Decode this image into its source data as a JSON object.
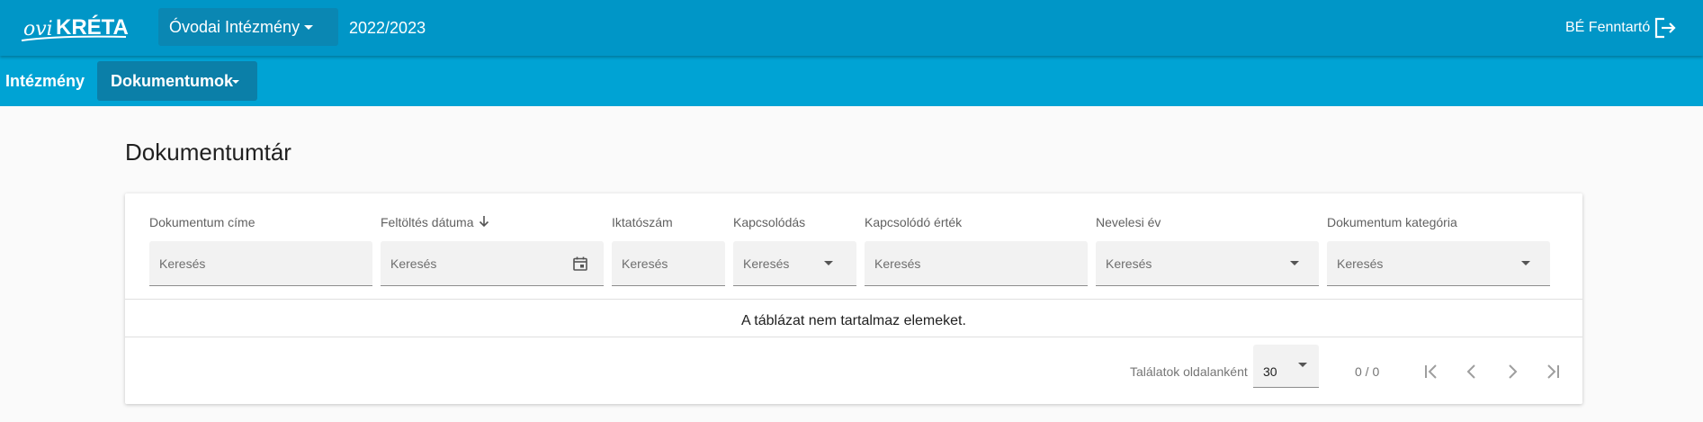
{
  "header": {
    "logo_text": "oviKRÉTA",
    "institution": "Óvodai Intézmény",
    "school_year": "2022/2023",
    "user": "BÉ Fenntartó",
    "color": "#0096c7"
  },
  "nav": {
    "items": [
      {
        "label": "Intézmény"
      },
      {
        "label": "Dokumentumok",
        "active": true
      }
    ],
    "color": "#00a3d4"
  },
  "page": {
    "title": "Dokumentumtár"
  },
  "table": {
    "columns": [
      {
        "label": "Dokumentum címe",
        "placeholder": "Keresés",
        "type": "text"
      },
      {
        "label": "Feltöltés dátuma",
        "placeholder": "Keresés",
        "type": "date",
        "sorted": "descending"
      },
      {
        "label": "Iktatószám",
        "placeholder": "Keresés",
        "type": "text"
      },
      {
        "label": "Kapcsolódás",
        "placeholder": "Keresés",
        "type": "select"
      },
      {
        "label": "Kapcsolódó érték",
        "placeholder": "Keresés",
        "type": "text"
      },
      {
        "label": "Nevelesi év",
        "placeholder": "Keresés",
        "type": "select"
      },
      {
        "label": "Dokumentum kategória",
        "placeholder": "Keresés",
        "type": "select"
      }
    ],
    "empty_message": "A táblázat nem tartalmaz elemeket."
  },
  "pagination": {
    "per_page_label": "Találatok oldalanként",
    "per_page_value": "30",
    "range": "0 / 0",
    "buttons": [
      "first-page-icon",
      "previous-page-icon",
      "next-page-icon",
      "last-page-icon"
    ]
  }
}
